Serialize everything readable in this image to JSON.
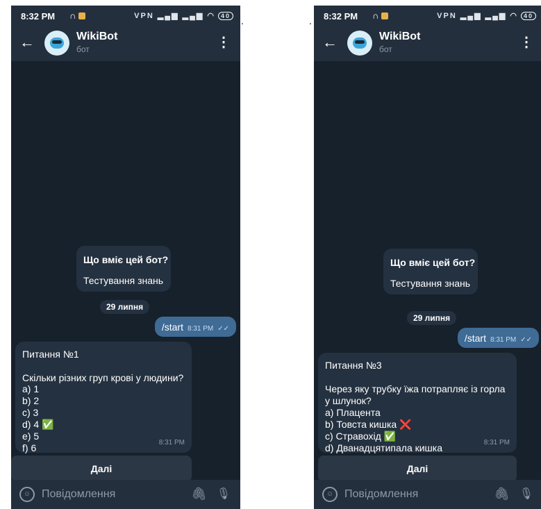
{
  "left": {
    "status": {
      "time": "8:32 PM",
      "battery": "40"
    },
    "chat": {
      "title": "WikiBot",
      "subtitle": "бот"
    },
    "bot_info": {
      "q": "Що вміє цей бот?",
      "a": "Тестування знань"
    },
    "date": "29 липня",
    "out_msg": {
      "text": "/start",
      "time": "8:31 PM"
    },
    "question": {
      "header": "Питання №1",
      "text": "Скільки різних груп крові у людини?",
      "options": [
        "a) 1",
        "b) 2",
        "c) 3",
        "d) 4",
        "e) 5",
        "f) 6"
      ],
      "marks": [
        "",
        "",
        "",
        "check",
        "",
        ""
      ],
      "time": "8:31 PM"
    },
    "button": "Далі",
    "input": {
      "placeholder": "Повідомлення"
    }
  },
  "right": {
    "status": {
      "time": "8:32 PM",
      "battery": "40"
    },
    "chat": {
      "title": "WikiBot",
      "subtitle": "бот"
    },
    "bot_info": {
      "q": "Що вміє цей бот?",
      "a": "Тестування знань"
    },
    "date": "29 липня",
    "out_msg": {
      "text": "/start",
      "time": "8:31 PM"
    },
    "question": {
      "header": "Питання №3",
      "text": "Через яку трубку їжа потрапляє із горла у шлунок?",
      "options": [
        "a) Плацента",
        "b) Товста кишка",
        "c) Стравохід",
        "d) Дванадцятипала кишка"
      ],
      "marks": [
        "",
        "cross",
        "check",
        ""
      ],
      "time": "8:31 PM"
    },
    "button": "Далі",
    "input": {
      "placeholder": "Повідомлення"
    }
  },
  "icons": {
    "check": "✅",
    "cross": "❌"
  },
  "colors": {
    "background": "#17212b",
    "bubble_out": "#3f6b95",
    "bubble_in": "#243140"
  }
}
